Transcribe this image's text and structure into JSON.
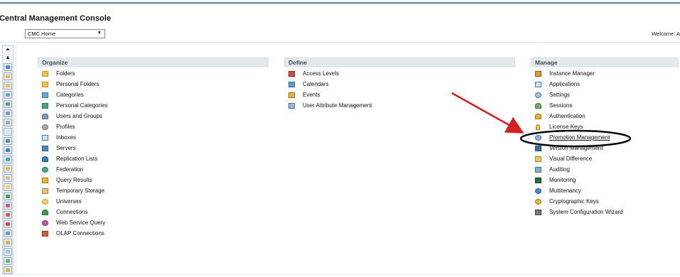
{
  "app": {
    "title": "Central Management Console",
    "welcome": "Welcome: A"
  },
  "home_select": {
    "value": "CMC Home"
  },
  "sections": {
    "organize": {
      "header": "Organize",
      "items": [
        {
          "label": "Folders",
          "icon": "folder-icon"
        },
        {
          "label": "Personal Folders",
          "icon": "personal-folder-icon"
        },
        {
          "label": "Categories",
          "icon": "categories-icon"
        },
        {
          "label": "Personal Categories",
          "icon": "personal-categories-icon"
        },
        {
          "label": "Users and Groups",
          "icon": "users-groups-icon"
        },
        {
          "label": "Profiles",
          "icon": "profiles-icon"
        },
        {
          "label": "Inboxes",
          "icon": "inbox-icon"
        },
        {
          "label": "Servers",
          "icon": "server-icon"
        },
        {
          "label": "Replication Lists",
          "icon": "replication-icon"
        },
        {
          "label": "Federation",
          "icon": "federation-icon"
        },
        {
          "label": "Query Results",
          "icon": "query-results-icon"
        },
        {
          "label": "Temporary Storage",
          "icon": "temporary-storage-icon"
        },
        {
          "label": "Universes",
          "icon": "universe-icon"
        },
        {
          "label": "Connections",
          "icon": "connection-icon"
        },
        {
          "label": "Web Service Query",
          "icon": "web-service-icon"
        },
        {
          "label": "OLAP Connections",
          "icon": "olap-icon"
        }
      ]
    },
    "define": {
      "header": "Define",
      "items": [
        {
          "label": "Access Levels",
          "icon": "access-levels-icon"
        },
        {
          "label": "Calendars",
          "icon": "calendar-icon"
        },
        {
          "label": "Events",
          "icon": "events-icon"
        },
        {
          "label": "User Attribute Management",
          "icon": "user-attribute-icon"
        }
      ]
    },
    "manage": {
      "header": "Manage",
      "items": [
        {
          "label": "Instance Manager",
          "icon": "instance-manager-icon"
        },
        {
          "label": "Applications",
          "icon": "applications-icon"
        },
        {
          "label": "Settings",
          "icon": "settings-icon"
        },
        {
          "label": "Sessions",
          "icon": "sessions-icon"
        },
        {
          "label": "Authentication",
          "icon": "authentication-icon"
        },
        {
          "label": "License Keys",
          "icon": "license-key-icon"
        },
        {
          "label": "Promotion Management",
          "icon": "promotion-icon"
        },
        {
          "label": "Version Management",
          "icon": "version-icon"
        },
        {
          "label": "Visual Difference",
          "icon": "visual-difference-icon"
        },
        {
          "label": "Auditing",
          "icon": "auditing-icon"
        },
        {
          "label": "Monitoring",
          "icon": "monitoring-icon"
        },
        {
          "label": "Multitenancy",
          "icon": "multitenancy-icon"
        },
        {
          "label": "Cryptographic Keys",
          "icon": "crypto-key-icon"
        },
        {
          "label": "System Configuration Wizard",
          "icon": "system-config-icon"
        }
      ]
    }
  },
  "annotation": {
    "arrow_color": "#d32020",
    "ellipse_color": "#000000",
    "highlighted_item": "Promotion Management"
  },
  "colors": {
    "header_bg": "#e4e9ef",
    "header_text": "#3d4a5a",
    "top_rule": "#6b86a6"
  }
}
